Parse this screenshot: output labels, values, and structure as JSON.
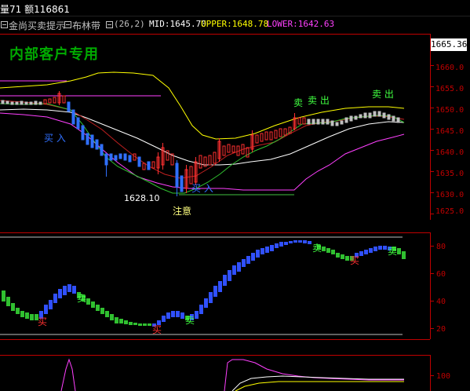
{
  "topbar": {
    "left_text": "量71 额116861"
  },
  "legend": {
    "indicator_name": "金尚买卖提示",
    "band_name": "布林带",
    "params": "(26,2)",
    "mid_label": "MID:1645.70",
    "upper_label": "UPPER:1648.78",
    "lower_label": "LOWER:1642.63",
    "mid_color": "#ffffff",
    "upper_color": "#ffff00",
    "lower_color": "#ff40ff"
  },
  "main_chart": {
    "watermark": "内部客户专用",
    "current_price": "1665.36",
    "y_ticks": [
      "1665.0",
      "1660.0",
      "1655.0",
      "1650.0",
      "1645.0",
      "1640.0",
      "1635.0",
      "1630.0",
      "1625.0"
    ],
    "annotations": {
      "buy_left": "买 入",
      "low_value": "1628.10",
      "buy_mid": "买 入",
      "attention": "注意",
      "sell_1": "卖",
      "sell_out_1": "卖 出",
      "sell_out_2": "卖 出"
    }
  },
  "sub_chart": {
    "y_ticks": [
      "80",
      "60",
      "40",
      "20"
    ],
    "labels": {
      "buy_1": "买",
      "sell_1": "卖",
      "buy_2": "买",
      "sell_2": "卖",
      "sell_3": "卖",
      "buy_3": "买",
      "sell_4": "卖"
    }
  },
  "bottom_chart": {
    "y_ticks": [
      "100"
    ]
  }
}
